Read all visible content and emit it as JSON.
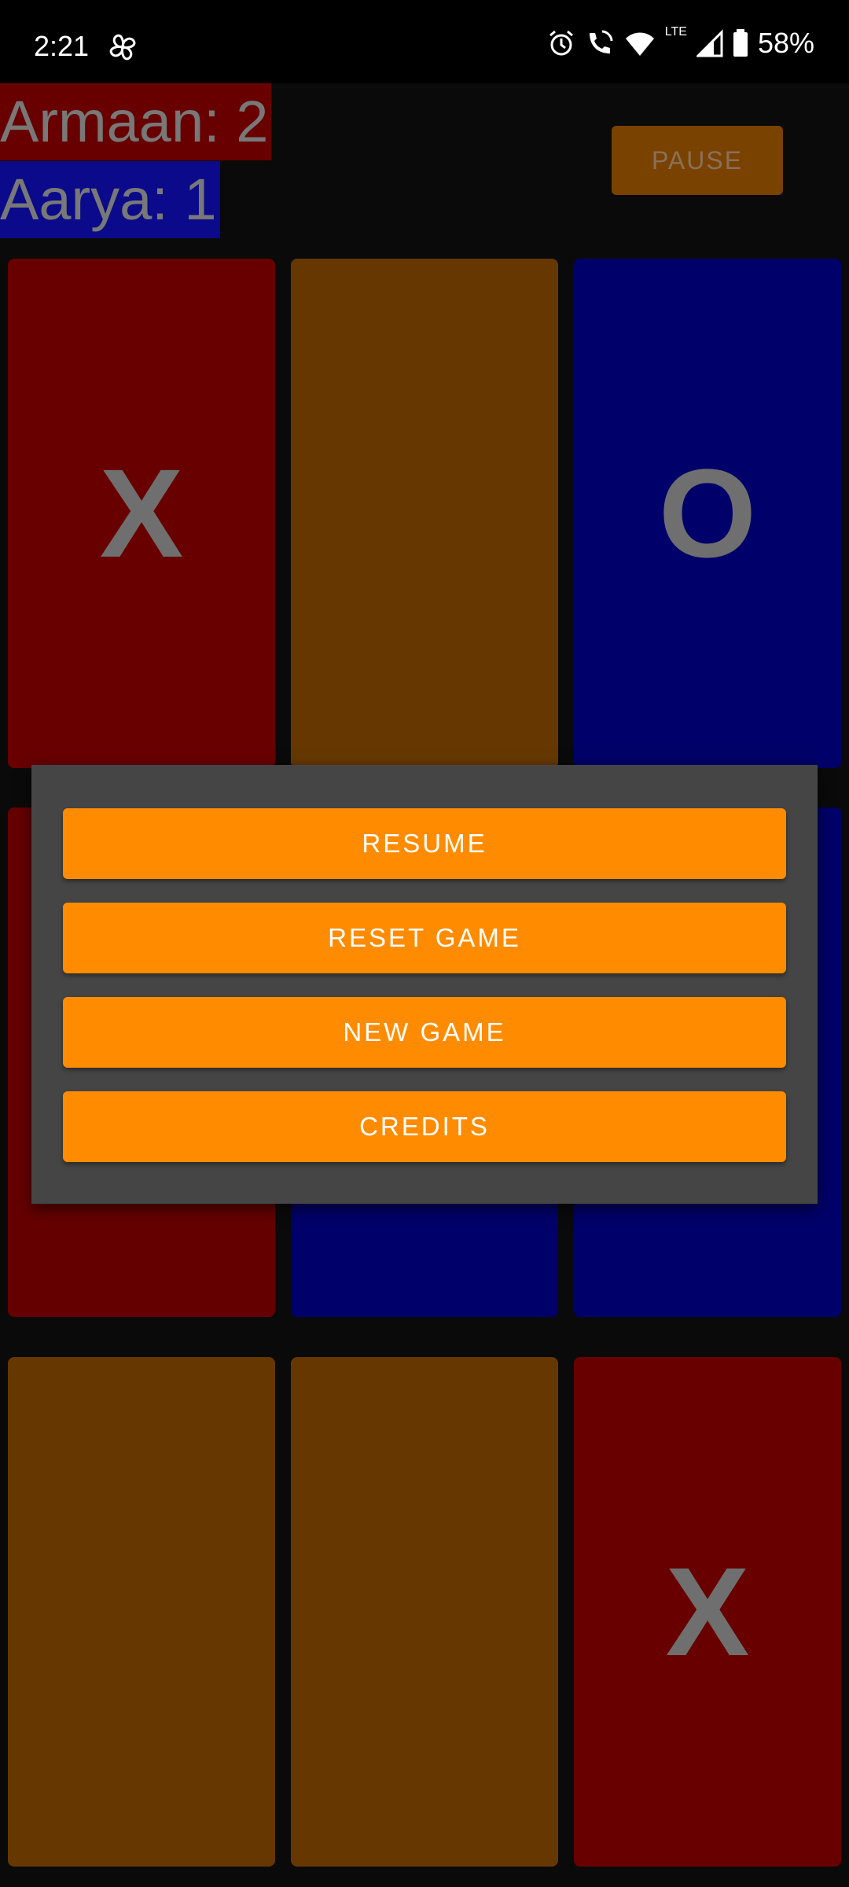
{
  "status": {
    "time": "2:21",
    "battery": "58%",
    "network": "LTE"
  },
  "scores": {
    "player1": "Armaan: 2",
    "player2": "Aarya: 1"
  },
  "pause_label": "PAUSE",
  "board": {
    "cells": [
      {
        "mark": "X",
        "color": "#680000"
      },
      {
        "mark": "",
        "color": "#663800"
      },
      {
        "mark": "O",
        "color": "#00006a"
      },
      {
        "mark": "",
        "color": "#650000"
      },
      {
        "mark": "",
        "color": "#00006a"
      },
      {
        "mark": "",
        "color": "#00006a"
      },
      {
        "mark": "",
        "color": "#663800"
      },
      {
        "mark": "",
        "color": "#663800"
      },
      {
        "mark": "X",
        "color": "#680000"
      }
    ]
  },
  "menu": {
    "resume": "RESUME",
    "reset": "RESET GAME",
    "new_game": "NEW GAME",
    "credits": "CREDITS"
  },
  "colors": {
    "accent": "#ff8c00",
    "player1": "#680000",
    "player2": "#00006a",
    "empty": "#663800"
  }
}
